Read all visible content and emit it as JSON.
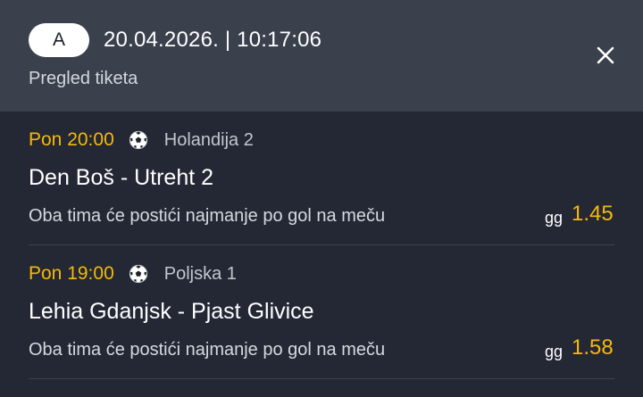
{
  "header": {
    "badge": "A",
    "datetime": "20.04.2026. | 10:17:06",
    "subtitle": "Pregled tiketa",
    "close_icon": "close-icon"
  },
  "colors": {
    "header_bg": "#3a404c",
    "content_bg": "#232834",
    "accent": "#f5b90b"
  },
  "matches": [
    {
      "time": "Pon 20:00",
      "sport_icon": "soccer-ball-icon",
      "league": "Holandija 2",
      "teams": "Den Boš - Utreht 2",
      "market": "Oba tima će postići najmanje po gol na meču",
      "pick": "gg",
      "odds": "1.45"
    },
    {
      "time": "Pon 19:00",
      "sport_icon": "soccer-ball-icon",
      "league": "Poljska 1",
      "teams": "Lehia Gdanjsk - Pjast Glivice",
      "market": "Oba tima će postići najmanje po gol na meču",
      "pick": "gg",
      "odds": "1.58"
    }
  ]
}
